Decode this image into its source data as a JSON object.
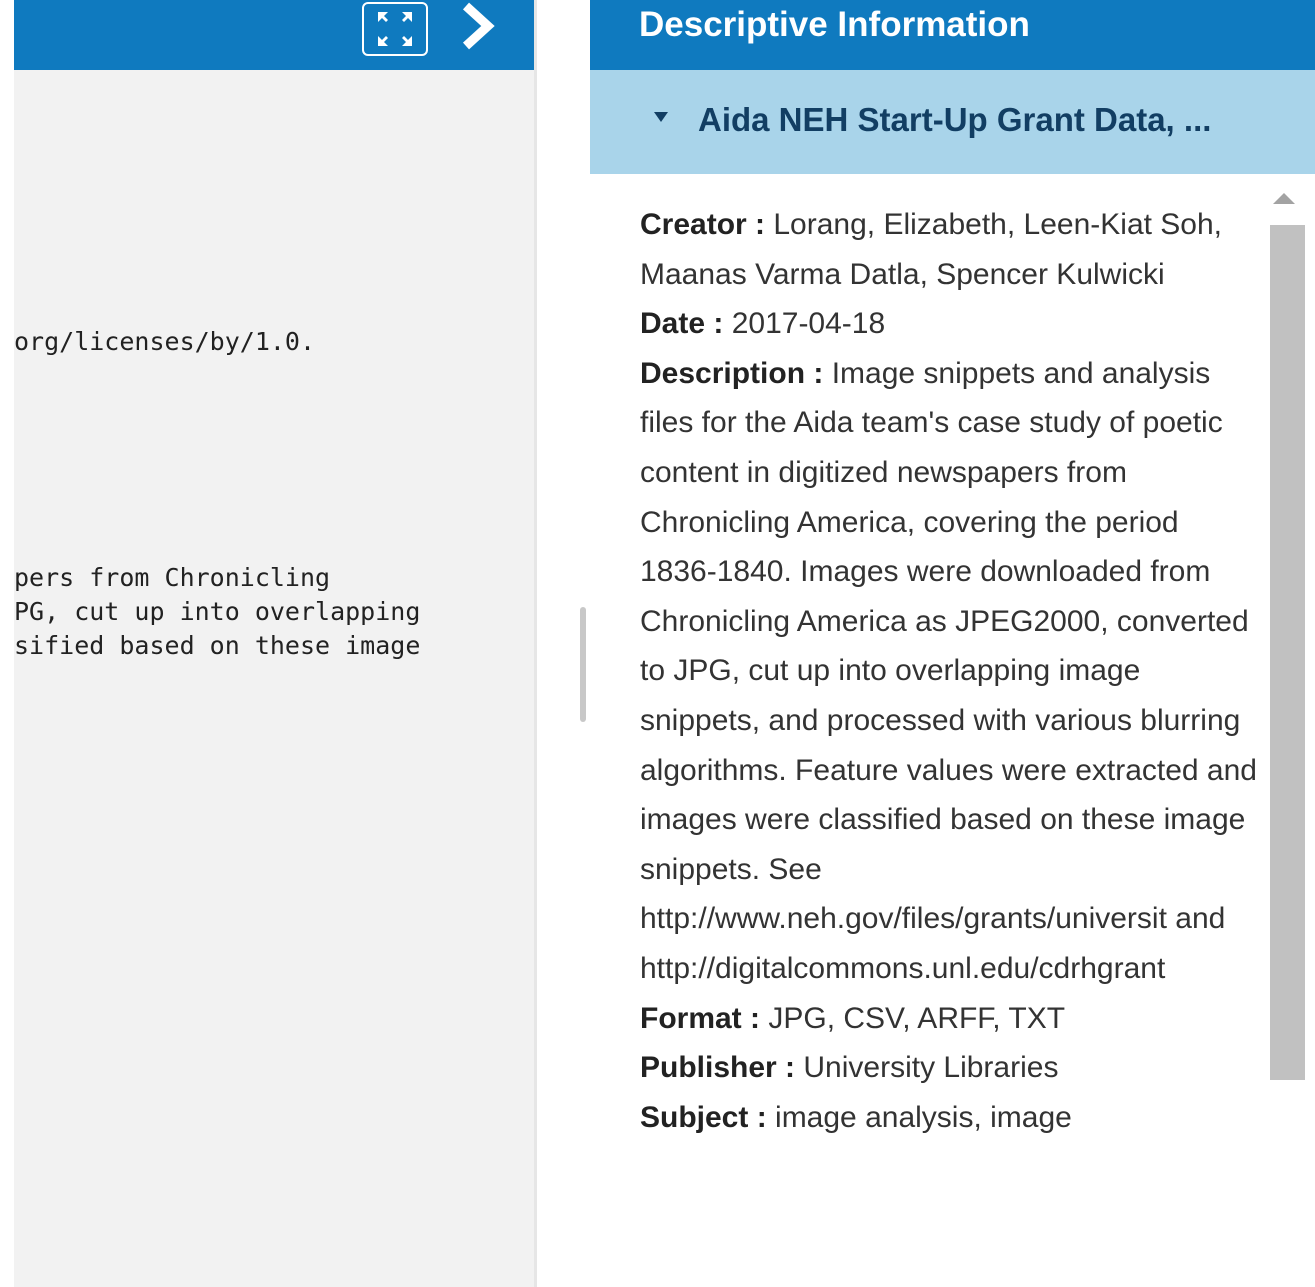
{
  "left_pane": {
    "license_snippet": "org/licenses/by/1.0.",
    "description_snippet_lines": [
      "pers from Chronicling",
      "PG, cut up into overlapping",
      "sified based on these image"
    ]
  },
  "right_pane": {
    "header_title": "Descriptive Information",
    "dataset_title": "Aida NEH Start-Up Grant Data, ...",
    "fields": {
      "creator": {
        "label": "Creator :",
        "value": "Lorang, Elizabeth, Leen-Kiat Soh, Maanas Varma Datla, Spencer Kulwicki"
      },
      "date": {
        "label": "Date :",
        "value": "2017-04-18"
      },
      "description": {
        "label": "Description :",
        "value": "Image snippets and analysis files for the Aida team's case study of poetic content in digitized newspapers from Chronicling America, covering the period 1836-1840. Images were downloaded from Chronicling America as JPEG2000, converted to JPG, cut up into overlapping image snippets, and processed with various blurring algorithms. Feature values were extracted and images were classified based on these image snippets. See http://www.neh.gov/files/grants/universit and http://digitalcommons.unl.edu/cdrhgrant"
      },
      "format": {
        "label": "Format :",
        "value": "JPG, CSV, ARFF, TXT"
      },
      "publisher": {
        "label": "Publisher :",
        "value": "University Libraries"
      },
      "subject": {
        "label": "Subject :",
        "value": "image analysis, image"
      }
    }
  },
  "icons": {
    "expand": "expand-icon",
    "next": "chevron-right-icon",
    "collapse": "caret-down-icon",
    "scroll_up": "scroll-up-arrow-icon"
  },
  "colors": {
    "header_blue": "#0f7abf",
    "subheader_blue": "#a9d4ea",
    "dataset_title": "#123e63",
    "left_bg": "#f2f2f2"
  }
}
